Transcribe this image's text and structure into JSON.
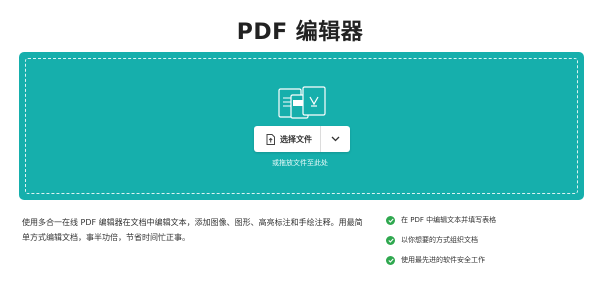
{
  "page": {
    "title": "PDF 编辑器"
  },
  "upload": {
    "icon": "pdf-documents-icon",
    "choose_files_label": "选择文件",
    "file_icon": "file-upload-icon",
    "dropdown_icon": "chevron-down-icon",
    "drop_hint": "或拖放文件至此处",
    "panel_color": "#16afac"
  },
  "description": "使用多合一在线 PDF 编辑器在文档中编辑文本，添加图像、图形、高亮标注和手绘注释。用最简单方式编辑文档，事半功倍，节省时间忙正事。",
  "features": [
    {
      "icon": "check-circle-icon",
      "text": "在 PDF 中编辑文本并填写表格"
    },
    {
      "icon": "check-circle-icon",
      "text": "以你想要的方式组织文档"
    },
    {
      "icon": "check-circle-icon",
      "text": "使用最先进的软件安全工作"
    }
  ],
  "colors": {
    "check": "#2fa84f"
  }
}
